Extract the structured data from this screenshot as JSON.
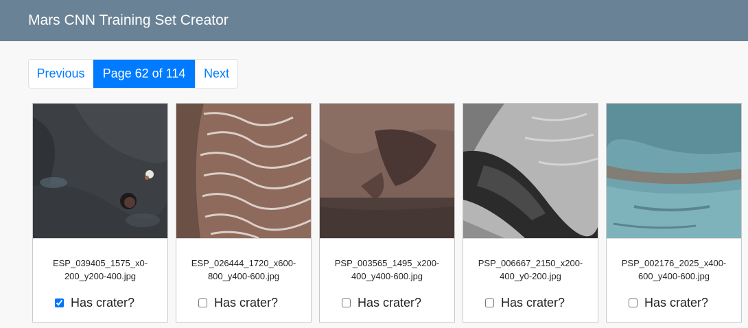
{
  "app": {
    "title": "Mars CNN Training Set Creator"
  },
  "pager": {
    "previous_label": "Previous",
    "current_label": "Page 62 of 114",
    "next_label": "Next"
  },
  "images": [
    {
      "filename": "ESP_039405_1575_x0-200_y200-400.jpg",
      "checkbox_label": "Has crater?",
      "checked": true
    },
    {
      "filename": "ESP_026444_1720_x600-800_y400-600.jpg",
      "checkbox_label": "Has crater?",
      "checked": false
    },
    {
      "filename": "PSP_003565_1495_x200-400_y400-600.jpg",
      "checkbox_label": "Has crater?",
      "checked": false
    },
    {
      "filename": "PSP_006667_2150_x200-400_y0-200.jpg",
      "checkbox_label": "Has crater?",
      "checked": false
    },
    {
      "filename": "PSP_002176_2025_x400-600_y400-600.jpg",
      "checkbox_label": "Has crater?",
      "checked": false
    }
  ],
  "colors": {
    "navbar": "#6a8295",
    "accent": "#007bff"
  }
}
